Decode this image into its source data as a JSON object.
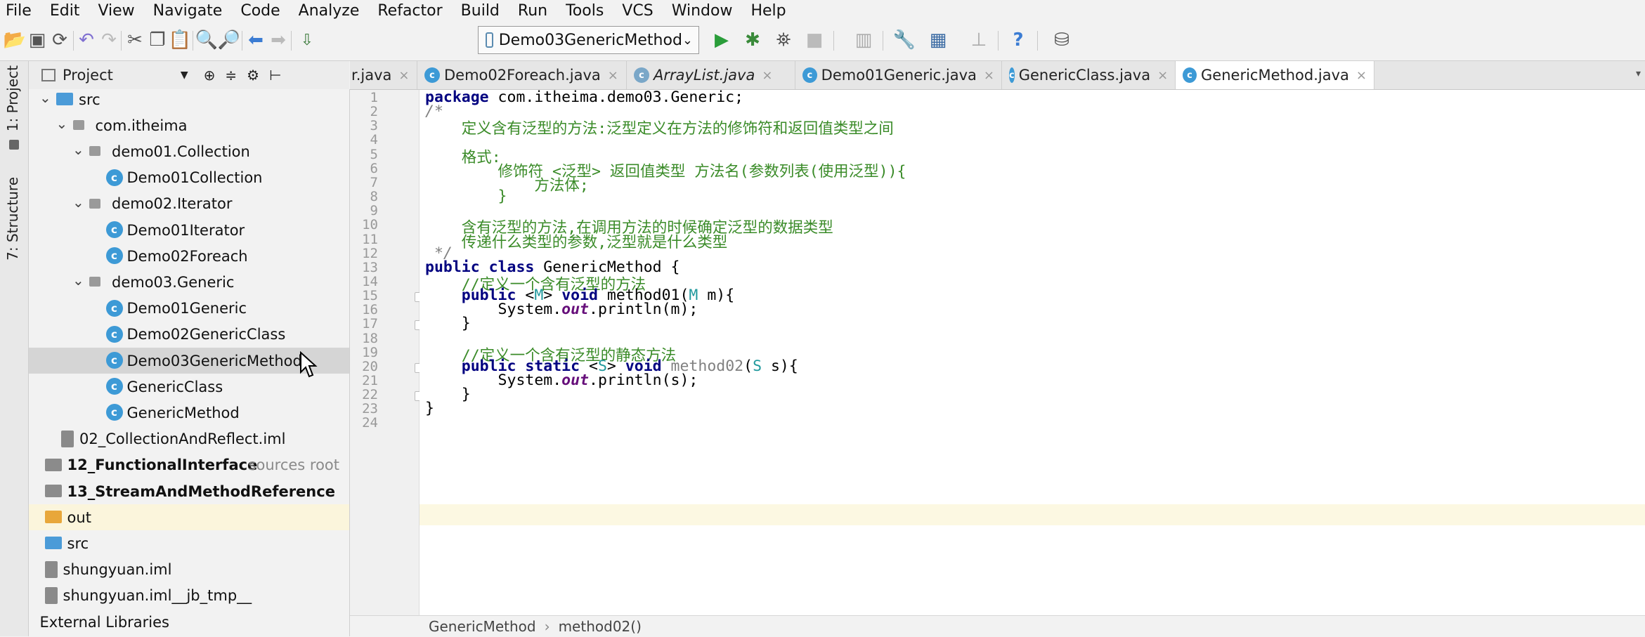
{
  "menu": [
    "File",
    "Edit",
    "View",
    "Navigate",
    "Code",
    "Analyze",
    "Refactor",
    "Build",
    "Run",
    "Tools",
    "VCS",
    "Window",
    "Help"
  ],
  "toolbar": {
    "run_config": "Demo03GenericMethod",
    "icons": [
      "open-icon",
      "save-icon",
      "sync-icon",
      "back-icon",
      "forward-icon",
      "cut-icon",
      "copy-icon",
      "paste-icon",
      "find-icon",
      "replace-icon",
      "nav-back-icon",
      "nav-forward-icon",
      "build-icon",
      "run-icon",
      "debug-icon",
      "coverage-icon",
      "stop-icon",
      "vcs-icon",
      "wrench-icon",
      "structure-icon",
      "sdk-icon",
      "help-icon",
      "db-icon"
    ]
  },
  "side_tabs": {
    "project": "1: Project",
    "structure": "7: Structure"
  },
  "project_panel": {
    "title": "Project"
  },
  "tree": [
    {
      "label": "src",
      "indent": 0,
      "type": "folder-blue",
      "arrow": "down"
    },
    {
      "label": "com.itheima",
      "indent": 1,
      "type": "package",
      "arrow": "down"
    },
    {
      "label": "demo01.Collection",
      "indent": 2,
      "type": "package",
      "arrow": "down"
    },
    {
      "label": "Demo01Collection",
      "indent": 3,
      "type": "class"
    },
    {
      "label": "demo02.Iterator",
      "indent": 2,
      "type": "package",
      "arrow": "down"
    },
    {
      "label": "Demo01Iterator",
      "indent": 3,
      "type": "class"
    },
    {
      "label": "Demo02Foreach",
      "indent": 3,
      "type": "class"
    },
    {
      "label": "demo03.Generic",
      "indent": 2,
      "type": "package",
      "arrow": "down"
    },
    {
      "label": "Demo01Generic",
      "indent": 3,
      "type": "class"
    },
    {
      "label": "Demo02GenericClass",
      "indent": 3,
      "type": "class"
    },
    {
      "label": "Demo03GenericMethod",
      "indent": 3,
      "type": "class",
      "selected": true
    },
    {
      "label": "GenericClass",
      "indent": 3,
      "type": "class"
    },
    {
      "label": "GenericMethod",
      "indent": 3,
      "type": "class"
    },
    {
      "label": "02_CollectionAndReflect.iml",
      "indent": 0.3,
      "type": "iml"
    },
    {
      "label": "12_FunctionalInterface",
      "extra": "sources root",
      "indent": -0.7,
      "type": "module",
      "bold": true
    },
    {
      "label": "13_StreamAndMethodReference",
      "indent": -0.7,
      "type": "module",
      "bold": true
    },
    {
      "label": "out",
      "indent": -0.7,
      "type": "folder-orange",
      "highlight": true
    },
    {
      "label": "src",
      "indent": -0.7,
      "type": "folder-blue"
    },
    {
      "label": "shungyuan.iml",
      "indent": -0.7,
      "type": "iml"
    },
    {
      "label": "shungyuan.iml__jb_tmp__",
      "indent": -0.7,
      "type": "iml"
    },
    {
      "label": "External Libraries",
      "indent": -1,
      "type": "none"
    }
  ],
  "tabs": [
    {
      "label": "r.java",
      "partial": true
    },
    {
      "label": "Demo02Foreach.java"
    },
    {
      "label": "ArrayList.java",
      "italic": true
    },
    {
      "label": "Demo01Generic.java"
    },
    {
      "label": "GenericClass.java"
    },
    {
      "label": "GenericMethod.java",
      "active": true
    }
  ],
  "code_lines": [
    "package com.itheima.demo03.Generic;",
    "/*",
    "    定义含有泛型的方法:泛型定义在方法的修饰符和返回值类型之间",
    "",
    "    格式:",
    "        修饰符 <泛型> 返回值类型 方法名(参数列表(使用泛型)){",
    "            方法体;",
    "        }",
    "",
    "    含有泛型的方法,在调用方法的时候确定泛型的数据类型",
    "    传递什么类型的参数,泛型就是什么类型",
    " */",
    "public class GenericMethod {",
    "    //定义一个含有泛型的方法",
    "    public <M> void method01(M m){",
    "        System.out.println(m);",
    "    }",
    "",
    "    //定义一个含有泛型的静态方法",
    "    public static <S> void method02(S s){",
    "        System.out.println(s);",
    "    }",
    "}",
    ""
  ],
  "current_line": 21,
  "breadcrumb": [
    "GenericMethod",
    "method02()"
  ],
  "colors": {
    "keyword": "#000080",
    "doc_comment": "#3a8b28",
    "comment": "#808080",
    "type_param": "#20999d",
    "static_field": "#660e7a",
    "class_icon": "#3d9ad6"
  }
}
